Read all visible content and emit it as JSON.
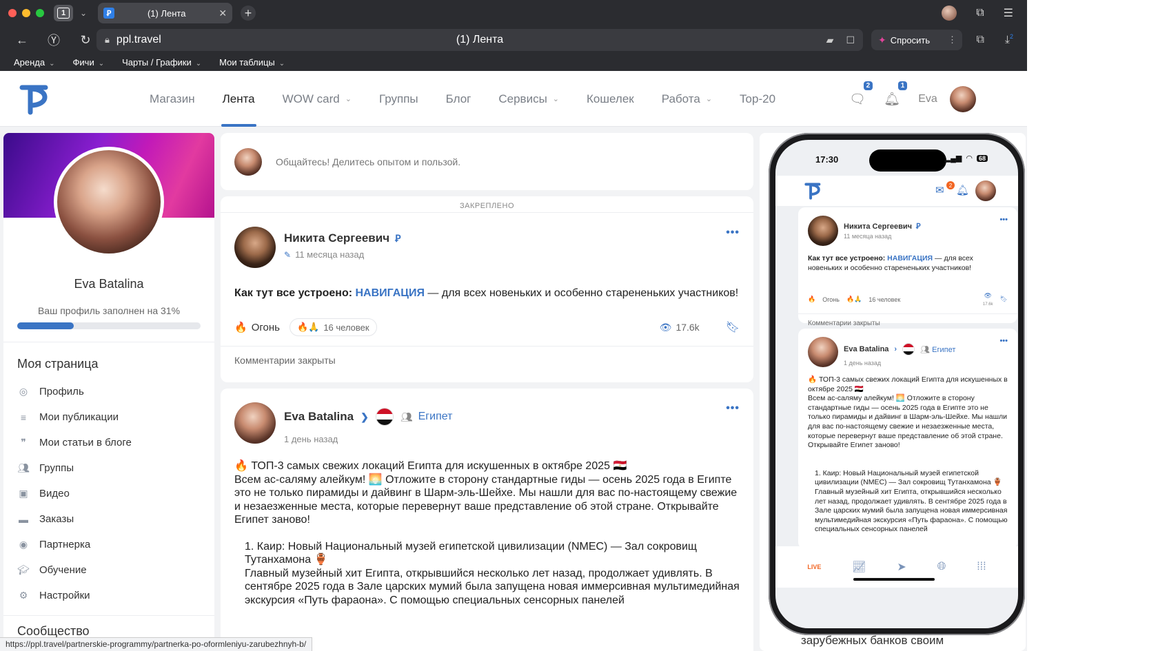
{
  "browser": {
    "tab_count": "1",
    "tab_title": "(1) Лента",
    "tab_favicon": "Ꝑ",
    "url": "ppl.travel",
    "page_title": "(1) Лента",
    "ask_label": "Спросить",
    "download_badge": "2",
    "bookmarks": [
      "Аренда",
      "Фичи",
      "Чарты / Графики",
      "Мои таблицы"
    ]
  },
  "site": {
    "nav": [
      {
        "label": "Магазин",
        "dropdown": false,
        "active": false
      },
      {
        "label": "Лента",
        "dropdown": false,
        "active": true
      },
      {
        "label": "WOW card",
        "dropdown": true,
        "active": false
      },
      {
        "label": "Группы",
        "dropdown": false,
        "active": false
      },
      {
        "label": "Блог",
        "dropdown": false,
        "active": false
      },
      {
        "label": "Сервисы",
        "dropdown": true,
        "active": false
      },
      {
        "label": "Кошелек",
        "dropdown": false,
        "active": false
      },
      {
        "label": "Работа",
        "dropdown": true,
        "active": false
      },
      {
        "label": "Top-20",
        "dropdown": false,
        "active": false
      }
    ],
    "messages_badge": "2",
    "notifications_badge": "1",
    "user_name": "Eva",
    "accent_color": "#3a74c4"
  },
  "profile": {
    "name": "Eva Batalina",
    "fill_text": "Ваш профиль заполнен на 31%",
    "fill_percent": 31,
    "section_title": "Моя страница",
    "menu": [
      {
        "label": "Профиль",
        "icon": "user-circle-icon"
      },
      {
        "label": "Мои публикации",
        "icon": "list-icon"
      },
      {
        "label": "Мои статьи в блоге",
        "icon": "quote-icon"
      },
      {
        "label": "Группы",
        "icon": "users-icon"
      },
      {
        "label": "Видео",
        "icon": "video-icon"
      },
      {
        "label": "Заказы",
        "icon": "card-icon"
      },
      {
        "label": "Партнерка",
        "icon": "partner-icon"
      },
      {
        "label": "Обучение",
        "icon": "graduation-icon"
      },
      {
        "label": "Настройки",
        "icon": "settings-icon"
      }
    ],
    "community_title": "Сообщество"
  },
  "feed": {
    "composer_placeholder": "Общайтесь! Делитесь опытом и пользой.",
    "pinned_label": "ЗАКРЕПЛЕНО",
    "pinned_post": {
      "author": "Никита Сергеевич",
      "time": "11 месяца назад",
      "text_bold": "Как тут все устроено:",
      "text_link": "НАВИГАЦИЯ",
      "text_rest": " — для всех новеньких и особенно старененьких участников!",
      "reaction_label": "Огонь",
      "reactors": "16 человек",
      "views": "17.6k",
      "comments_closed": "Комментарии закрыты"
    },
    "post2": {
      "author": "Eva Batalina",
      "group": "Египет",
      "time": "1 день назад",
      "lines": [
        "🔥 ТОП-3 самых свежих локаций Египта для искушенных в октябре 2025 🇪🇬",
        "Всем ас-саляму алейкум! 🌅 Отложите в сторону стандартные гиды — осень 2025 года в Египте это не только пирамиды и дайвинг в Шарм-эль-Шейхе. Мы нашли для вас по-настоящему свежие и незаезженные места, которые перевернут ваше представление об этой стране. Открывайте Египет заново!",
        "1. Каир: Новый Национальный музей египетской цивилизации (NMEC) — Зал сокровищ Тутанхамона 🏺",
        "Главный музейный хит Египта, открывшийся несколько лет назад, продолжает удивлять. В сентябре 2025 года в Зале царских мумий была запущена новая иммерсивная мультимедийная экскурсия «Путь фараона». С помощью специальных сенсорных панелей"
      ]
    }
  },
  "phone": {
    "time": "17:30",
    "battery": "68",
    "mail_badge": "2",
    "pinned_views": "17.6k",
    "reaction_label": "Огонь",
    "reactors": "16 человек",
    "comments_closed": "Комментарии закрыты",
    "nav_live": "LIVE"
  },
  "right_column_text": "зарубежных банков своим",
  "status_url": "https://ppl.travel/partnerskie-programmy/partnerka-po-oformleniyu-zarubezhnyh-b/"
}
